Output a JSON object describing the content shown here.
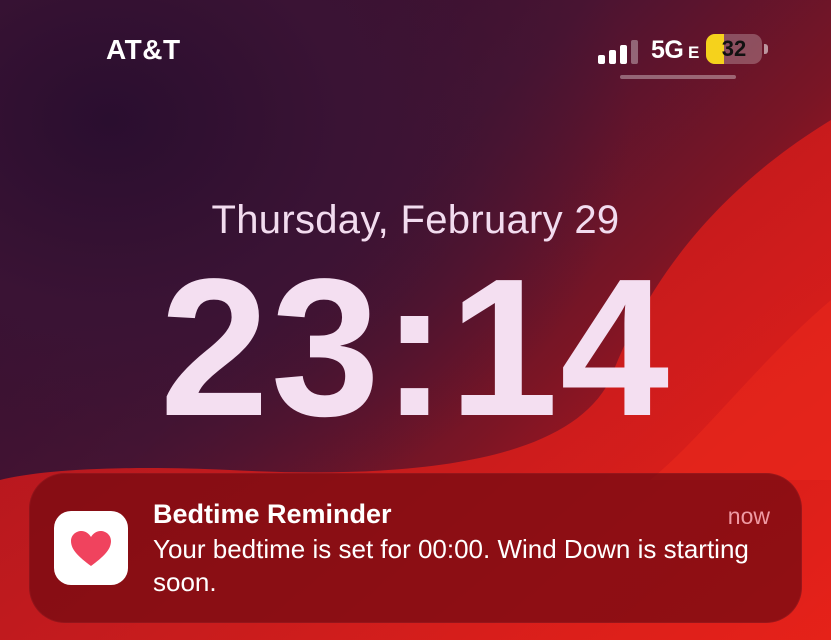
{
  "status_bar": {
    "carrier": "AT&T",
    "network": "5G",
    "network_sub": "E",
    "battery_level": "32",
    "battery_percent": 32,
    "signal_bars_active": 3,
    "signal_bars_total": 4
  },
  "lock_screen": {
    "date": "Thursday, February 29",
    "time": "23:14"
  },
  "notification": {
    "app_icon": "heart-icon",
    "title": "Bedtime Reminder",
    "time": "now",
    "body": "Your bedtime is set for 00:00. Wind Down is starting soon."
  },
  "colors": {
    "battery_fill": "#f5d21c",
    "heart": "#f0435e",
    "notification_time": "#ef9aa3"
  }
}
